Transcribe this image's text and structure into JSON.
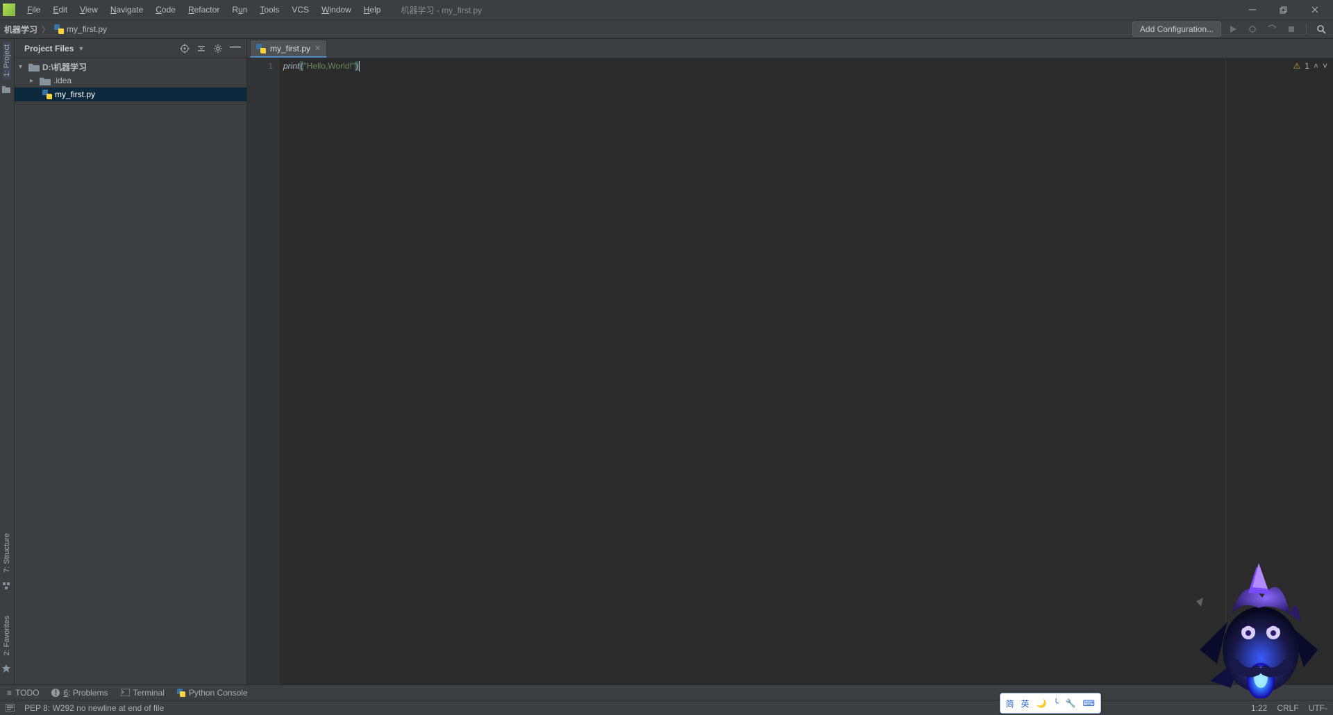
{
  "window": {
    "title": "机器学习 - my_first.py"
  },
  "menu": {
    "file": "File",
    "edit": "Edit",
    "view": "View",
    "navigate": "Navigate",
    "code": "Code",
    "refactor": "Refactor",
    "run": "Run",
    "tools": "Tools",
    "vcs": "VCS",
    "window": "Window",
    "help": "Help"
  },
  "breadcrumbs": {
    "root": "机器学习",
    "file": "my_first.py"
  },
  "toolbar": {
    "add_config": "Add Configuration..."
  },
  "left_strip": {
    "project": "1: Project",
    "structure": "7: Structure",
    "favorites": "2: Favorites"
  },
  "project_panel": {
    "title": "Project Files",
    "tree": {
      "root": "D:\\机器学习",
      "idea": ".idea",
      "file": "my_first.py"
    }
  },
  "editor": {
    "tab": "my_first.py",
    "line_no": "1",
    "code": {
      "fn": "print",
      "str": "\"Hello,World!\""
    },
    "inspection": {
      "count": "1"
    }
  },
  "bottom_tools": {
    "todo": "TODO",
    "problems": "6: Problems",
    "terminal": "Terminal",
    "pyconsole": "Python Console"
  },
  "statusbar": {
    "msg": "PEP 8: W292 no newline at end of file",
    "pos": "1:22",
    "eol": "CRLF",
    "enc": "UTF-"
  },
  "ime": {
    "a": "简",
    "b": "英"
  }
}
